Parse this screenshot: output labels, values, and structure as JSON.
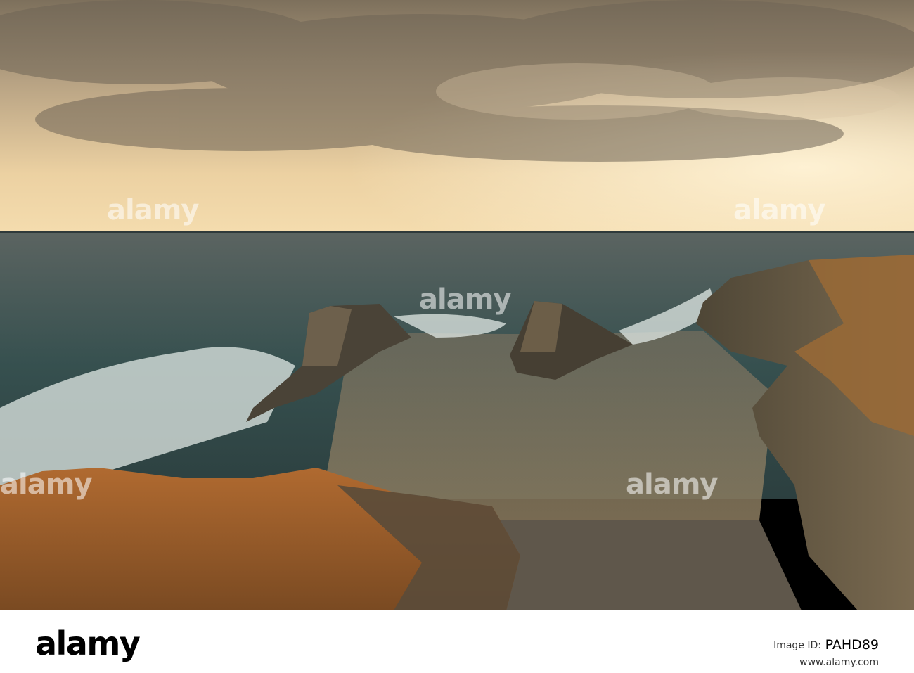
{
  "photo": {
    "scene": "sunset-sea-cove",
    "watermark_text": "alamy"
  },
  "footer": {
    "logo": "alamy",
    "image_id_label": "Image ID:",
    "image_id": "PAHD89",
    "url": "www.alamy.com"
  },
  "colors": {
    "sky_top": "#8a7a63",
    "sky_horizon": "#f4d7a5",
    "sea": "#3f4a47",
    "foam": "#dfe6e2",
    "cliff": "#6b5a45",
    "grass": "#a8652f"
  }
}
